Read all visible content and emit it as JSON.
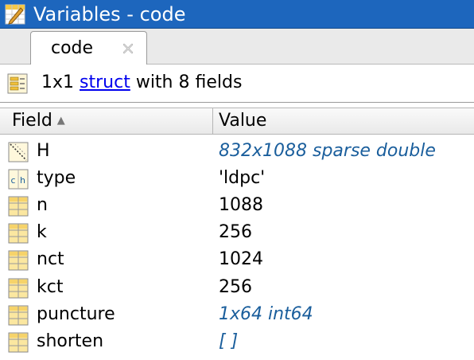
{
  "window": {
    "title": "Variables - code"
  },
  "tabs": [
    {
      "label": "code",
      "active": true
    }
  ],
  "summary": {
    "size": "1x1",
    "class_link": "struct",
    "suffix": "with 8 fields"
  },
  "table": {
    "columns": {
      "field": "Field",
      "value": "Value"
    },
    "sort_column": "Field",
    "sort_direction": "ascending",
    "rows": [
      {
        "icon": "sparse-matrix-icon",
        "field": "H",
        "value": "832x1088 sparse double",
        "value_is_link": true
      },
      {
        "icon": "char-icon",
        "field": "type",
        "value": "'ldpc'",
        "value_is_link": false
      },
      {
        "icon": "numeric-icon",
        "field": "n",
        "value": "1088",
        "value_is_link": false
      },
      {
        "icon": "numeric-icon",
        "field": "k",
        "value": "256",
        "value_is_link": false
      },
      {
        "icon": "numeric-icon",
        "field": "nct",
        "value": "1024",
        "value_is_link": false
      },
      {
        "icon": "numeric-icon",
        "field": "kct",
        "value": "256",
        "value_is_link": false
      },
      {
        "icon": "numeric-icon",
        "field": "puncture",
        "value": "1x64 int64",
        "value_is_link": true
      },
      {
        "icon": "numeric-icon",
        "field": "shorten",
        "value": "[ ]",
        "value_is_link": true
      }
    ]
  },
  "colors": {
    "titlebar": "#1d66bd",
    "link_value": "#1a5e9c",
    "hyperlink": "#0000ee"
  }
}
